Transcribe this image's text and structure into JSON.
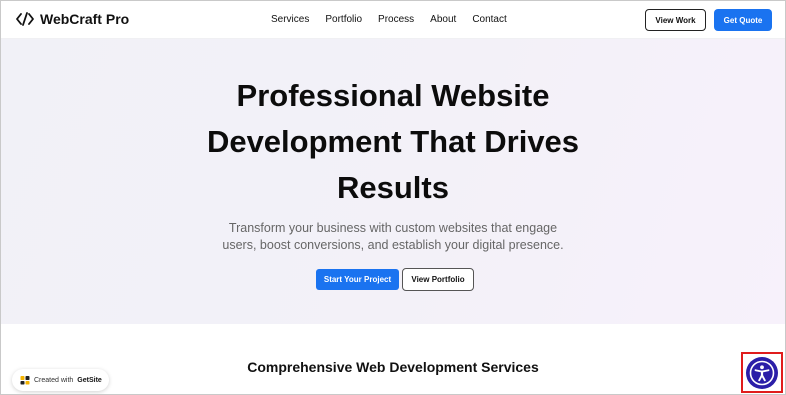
{
  "brand": {
    "name": "WebCraft Pro",
    "icon": "code-brackets-icon"
  },
  "nav": {
    "links": [
      "Services",
      "Portfolio",
      "Process",
      "About",
      "Contact"
    ],
    "view_work": "View Work",
    "get_quote": "Get Quote"
  },
  "hero": {
    "title_lines": [
      "Professional Website",
      "Development That Drives",
      "Results"
    ],
    "subtitle_lines": [
      "Transform your business with custom websites that engage",
      "users, boost conversions, and establish your digital presence."
    ],
    "primary_button": "Start Your Project",
    "secondary_button": "View Portfolio"
  },
  "services": {
    "title": "Comprehensive Web Development Services"
  },
  "badge": {
    "prefix": "Created with",
    "brand": "GetSite"
  },
  "accessibility": {
    "icon": "accessibility-icon"
  },
  "colors": {
    "accent": "#1a73f0",
    "accessibility_bg": "#2b1ea8",
    "highlight_border": "#e01c1c"
  }
}
